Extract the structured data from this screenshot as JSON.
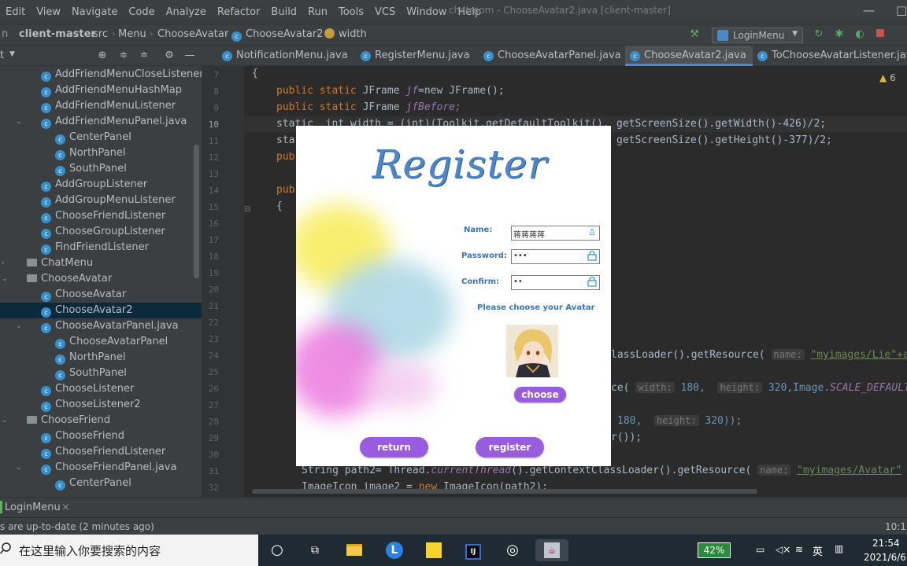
{
  "menubar": {
    "items": [
      "Edit",
      "View",
      "Navigate",
      "Code",
      "Analyze",
      "Refactor",
      "Build",
      "Run",
      "Tools",
      "VCS",
      "Window",
      "Help"
    ],
    "window_title": "chatroom - ChooseAvatar2.java [client-master]"
  },
  "navbar": {
    "breadcrumbs": [
      "client-master",
      "src",
      "Menu",
      "ChooseAvatar",
      "ChooseAvatar2",
      "width"
    ],
    "run_config": "LoginMenu"
  },
  "project": {
    "header_label": "t",
    "tree": [
      {
        "label": "AddFriendMenuCloseListener",
        "type": "class",
        "indent": 1
      },
      {
        "label": "AddFriendMenuHashMap",
        "type": "class",
        "indent": 1
      },
      {
        "label": "AddFriendMenuListener",
        "type": "class",
        "indent": 1
      },
      {
        "label": "AddFriendMenuPanel.java",
        "type": "class",
        "indent": 1,
        "expanded": true
      },
      {
        "label": "CenterPanel",
        "type": "class",
        "indent": 2
      },
      {
        "label": "NorthPanel",
        "type": "class",
        "indent": 2
      },
      {
        "label": "SouthPanel",
        "type": "class",
        "indent": 2
      },
      {
        "label": "AddGroupListener",
        "type": "class",
        "indent": 1
      },
      {
        "label": "AddGroupMenuListener",
        "type": "class",
        "indent": 1
      },
      {
        "label": "ChooseFriendListener",
        "type": "class",
        "indent": 1
      },
      {
        "label": "ChooseGroupListener",
        "type": "class",
        "indent": 1
      },
      {
        "label": "FindFriendListener",
        "type": "class",
        "indent": 1
      },
      {
        "label": "ChatMenu",
        "type": "folder",
        "indent": 0,
        "expanded": false
      },
      {
        "label": "ChooseAvatar",
        "type": "folder",
        "indent": 0,
        "expanded": true
      },
      {
        "label": "ChooseAvatar",
        "type": "class",
        "indent": 1
      },
      {
        "label": "ChooseAvatar2",
        "type": "class",
        "indent": 1,
        "selected": true
      },
      {
        "label": "ChooseAvatarPanel.java",
        "type": "class",
        "indent": 1,
        "expanded": true
      },
      {
        "label": "ChooseAvatarPanel",
        "type": "class",
        "indent": 2
      },
      {
        "label": "NorthPanel",
        "type": "class",
        "indent": 2
      },
      {
        "label": "SouthPanel",
        "type": "class",
        "indent": 2
      },
      {
        "label": "ChooseListener",
        "type": "class",
        "indent": 1
      },
      {
        "label": "ChooseListener2",
        "type": "class",
        "indent": 1
      },
      {
        "label": "ChooseFriend",
        "type": "folder",
        "indent": 0,
        "expanded": true
      },
      {
        "label": "ChooseFriend",
        "type": "class",
        "indent": 1
      },
      {
        "label": "ChooseFriendListener",
        "type": "class",
        "indent": 1
      },
      {
        "label": "ChooseFriendPanel.java",
        "type": "class",
        "indent": 1,
        "expanded": true
      },
      {
        "label": "CenterPanel",
        "type": "class",
        "indent": 2
      }
    ]
  },
  "tabs": [
    {
      "label": "NotificationMenu.java",
      "active": false
    },
    {
      "label": "RegisterMenu.java",
      "active": false
    },
    {
      "label": "ChooseAvatarPanel.java",
      "active": false
    },
    {
      "label": "ChooseAvatar2.java",
      "active": true
    },
    {
      "label": "ToChooseAvatarListener.java",
      "active": false
    }
  ],
  "editor": {
    "warning_count": "6",
    "line_numbers": [
      "7",
      "8",
      "9",
      "10",
      "11",
      "12",
      "13",
      "14",
      "15",
      "16",
      "17",
      "18",
      "19",
      "20",
      "21",
      "22",
      "23",
      "24",
      "25",
      "26",
      "27",
      "28",
      "29",
      "30",
      "31",
      "32"
    ],
    "current_line": "10"
  },
  "code": {
    "l7": "{",
    "l8_kw": "public static",
    "l8_type": "JFrame",
    "l8_var": "jf",
    "l8_rest": "=new JFrame();",
    "l9_kw": "public static",
    "l9_type": "JFrame",
    "l9_var": "jfBefore;",
    "l10_a": "static  int width = (int)(Toolkit.getDefaultToolkit().",
    "l10_b": "getScreenSize().getWidth()-426)/2;",
    "l11_a": "sta",
    "l11_b": "getScreenSize().getHeight()-377)/2;",
    "l12": "pub",
    "l14": "pub",
    "l15": "{",
    "l24_pre": "lassLoader().getResource(",
    "l24_hint": "name:",
    "l24_str": "\"myimages/Lie\"+a",
    "l25_pre": "ce(",
    "l25_hint1": "width:",
    "l25_num1": "180,",
    "l25_hint2": "height:",
    "l25_num2": "320,Image.",
    "l25_it": "SCALE_DEFAULT",
    "l25_end": "));",
    "l28_num1": "180,",
    "l28_hint": "height:",
    "l28_num2": "320));",
    "l29": "r());",
    "l31_a": "String path2= Thread.",
    "l31_it": "currentThread",
    "l31_b": "().getContextClassLoader().getResource(",
    "l31_hint": "name:",
    "l31_str": "\"myimages/Avatar\"",
    "l32_a": "ImageIcon image2 = ",
    "l32_kw": "new",
    "l32_b": " ImageIcon(path2);"
  },
  "bottom_tool": {
    "label": "LoginMenu"
  },
  "status": {
    "message": "s are up-to-date (2 minutes ago)",
    "position": "10:15"
  },
  "dialog": {
    "title": "Register",
    "name_label": "Name:",
    "name_value": "蒋蒋蒋蒋",
    "password_label": "Password:",
    "password_value": "•••",
    "confirm_label": "Confirm:",
    "confirm_value": "••",
    "avatar_prompt": "Please choose your Avatar",
    "choose_label": "choose",
    "return_label": "return",
    "register_label": "register"
  },
  "taskbar": {
    "search_placeholder": "在这里输入你要搜索的内容",
    "battery": "42%",
    "ime": "英",
    "time": "21:54",
    "date": "2021/6/6"
  },
  "colors": {
    "ide_bg": "#2b2b2b",
    "panel_bg": "#3c3f41",
    "accent_purple": "#9a5cdf",
    "title_blue": "#4f86c6"
  }
}
